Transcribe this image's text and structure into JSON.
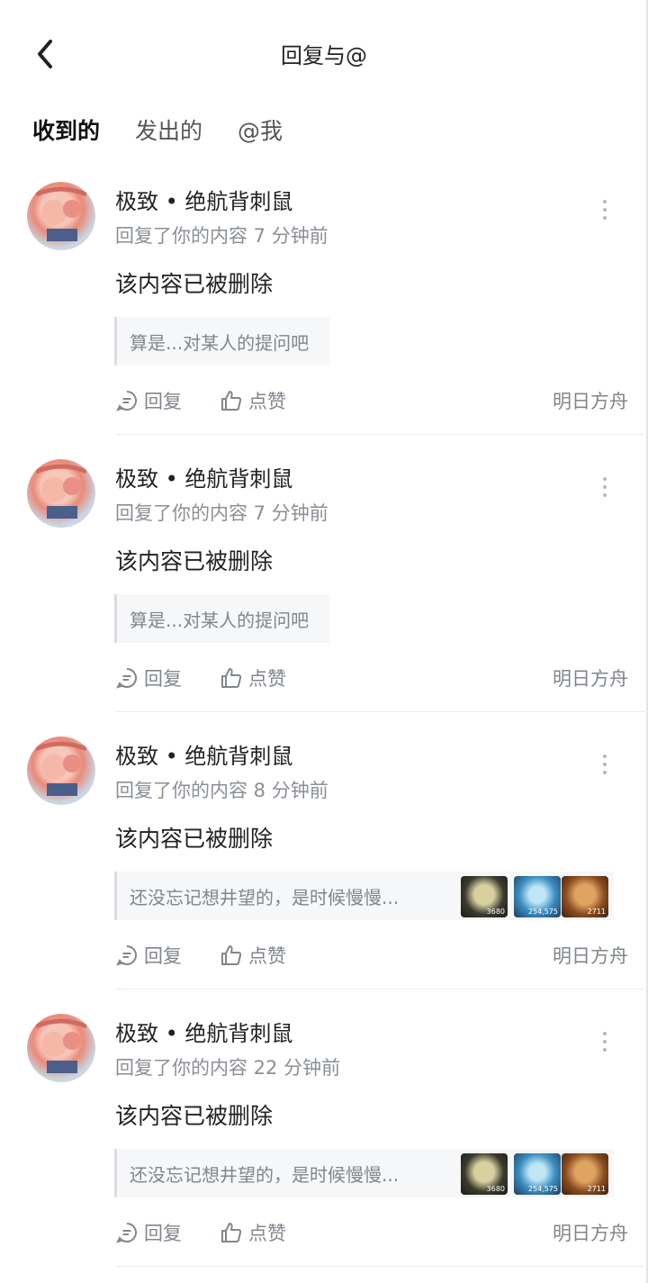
{
  "header": {
    "title": "回复与@"
  },
  "tabs": [
    {
      "label": "收到的",
      "active": true
    },
    {
      "label": "发出的",
      "active": false
    },
    {
      "label": "@我",
      "active": false
    }
  ],
  "colors": {
    "accent": "#3cc8b4",
    "text": "#222222",
    "muted": "#80868c"
  },
  "items": [
    {
      "name": "极致 • 绝航背刺鼠",
      "meta": "回复了你的内容 7 分钟前",
      "content": "该内容已被删除",
      "quote": "算是...对某人的提问吧",
      "reply_label": "回复",
      "like_label": "点赞",
      "game": "明日方舟"
    },
    {
      "name": "极致 • 绝航背刺鼠",
      "meta": "回复了你的内容 7 分钟前",
      "content": "该内容已被删除",
      "quote": "算是...对某人的提问吧",
      "reply_label": "回复",
      "like_label": "点赞",
      "game": "明日方舟"
    },
    {
      "name": "极致 • 绝航背刺鼠",
      "meta": "回复了你的内容 8 分钟前",
      "content": "该内容已被删除",
      "quote": "还没忘记想井望的，是时候慢慢...",
      "badges": [
        "3680",
        "254,575",
        "2711"
      ],
      "reply_label": "回复",
      "like_label": "点赞",
      "game": "明日方舟"
    },
    {
      "name": "极致 • 绝航背刺鼠",
      "meta": "回复了你的内容 22 分钟前",
      "content": "该内容已被删除",
      "quote": "还没忘记想井望的，是时候慢慢...",
      "badges": [
        "3680",
        "254,575",
        "2711"
      ],
      "reply_label": "回复",
      "like_label": "点赞",
      "game": "明日方舟"
    }
  ]
}
